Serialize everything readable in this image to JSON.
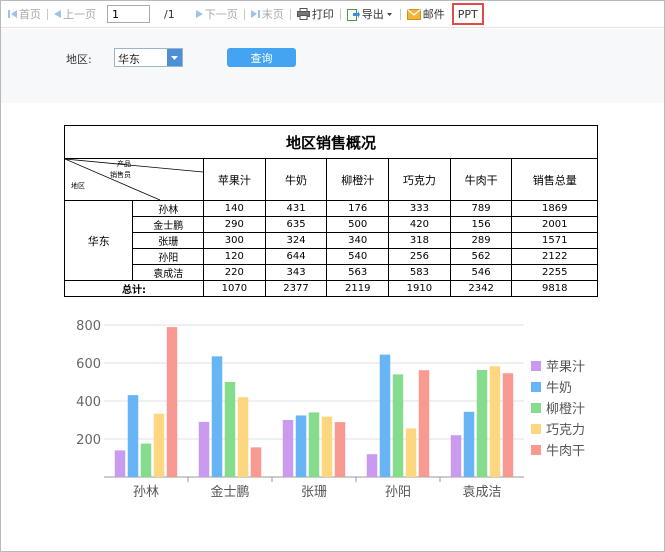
{
  "toolbar": {
    "first": "首页",
    "prev": "上一页",
    "page_value": "1",
    "page_total": "/1",
    "next": "下一页",
    "last": "末页",
    "print": "打印",
    "export": "导出",
    "mail": "邮件",
    "ppt": "PPT"
  },
  "filter": {
    "label": "地区:",
    "region": "华东",
    "query": "查询"
  },
  "report": {
    "title": "地区销售概况",
    "corner": {
      "product": "产品",
      "seller": "销售员",
      "region": "地区"
    },
    "columns": [
      "苹果汁",
      "牛奶",
      "柳橙汁",
      "巧克力",
      "牛肉干",
      "销售总量"
    ],
    "region": "华东",
    "rows": [
      {
        "name": "孙林",
        "values": [
          "140",
          "431",
          "176",
          "333",
          "789",
          "1869"
        ]
      },
      {
        "name": "金士鹏",
        "values": [
          "290",
          "635",
          "500",
          "420",
          "156",
          "2001"
        ]
      },
      {
        "name": "张珊",
        "values": [
          "300",
          "324",
          "340",
          "318",
          "289",
          "1571"
        ]
      },
      {
        "name": "孙阳",
        "values": [
          "120",
          "644",
          "540",
          "256",
          "562",
          "2122"
        ]
      },
      {
        "name": "袁成洁",
        "values": [
          "220",
          "343",
          "563",
          "583",
          "546",
          "2255"
        ]
      }
    ],
    "total_label": "总计:",
    "totals": [
      "1070",
      "2377",
      "2119",
      "1910",
      "2342",
      "9818"
    ]
  },
  "chart_data": {
    "type": "bar",
    "categories": [
      "孙林",
      "金士鹏",
      "张珊",
      "孙阳",
      "袁成洁"
    ],
    "series": [
      {
        "name": "苹果汁",
        "values": [
          140,
          290,
          300,
          120,
          220
        ],
        "color": "#c99af0"
      },
      {
        "name": "牛奶",
        "values": [
          431,
          635,
          324,
          644,
          343
        ],
        "color": "#67b5f5"
      },
      {
        "name": "柳橙汁",
        "values": [
          176,
          500,
          340,
          540,
          563
        ],
        "color": "#84dc8c"
      },
      {
        "name": "巧克力",
        "values": [
          333,
          420,
          318,
          256,
          583
        ],
        "color": "#fcd780"
      },
      {
        "name": "牛肉干",
        "values": [
          789,
          156,
          289,
          562,
          546
        ],
        "color": "#f99a92"
      }
    ],
    "yticks": [
      200,
      400,
      600,
      800
    ],
    "ylim": [
      0,
      800
    ],
    "grid": true,
    "legend": "right"
  }
}
